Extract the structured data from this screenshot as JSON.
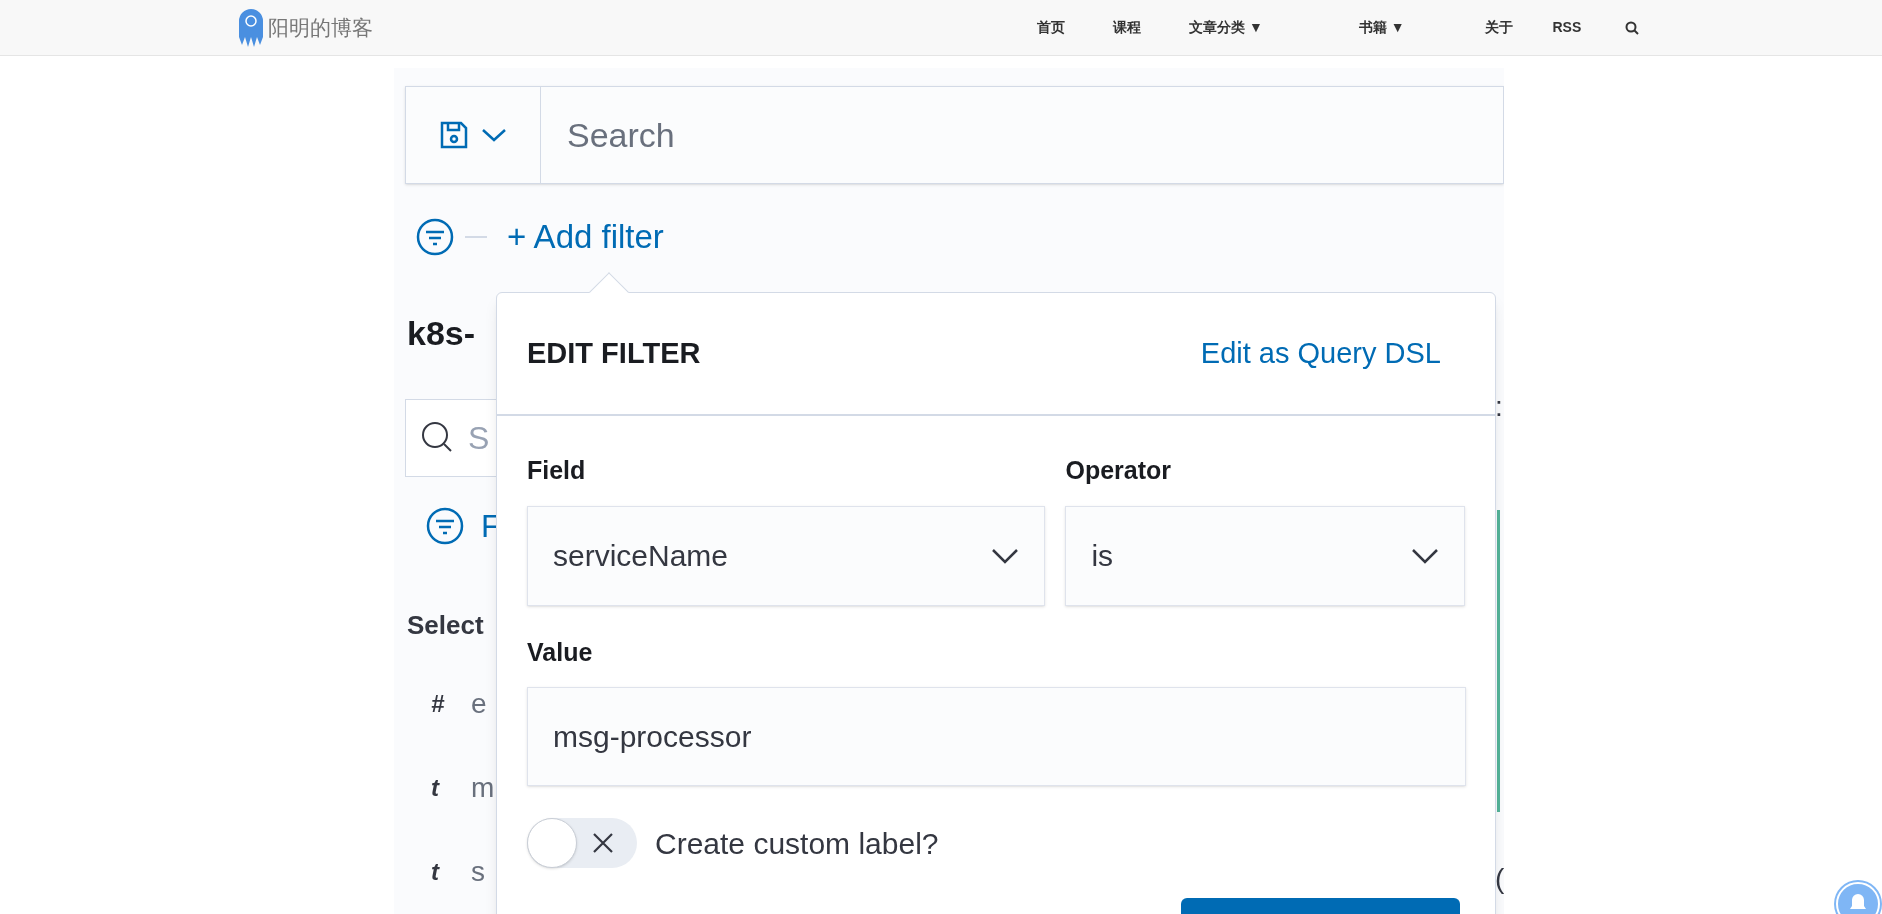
{
  "site": {
    "title": "阳明的博客",
    "nav": [
      {
        "label": "首页"
      },
      {
        "label": "课程"
      },
      {
        "label": "文章分类 ▼"
      },
      {
        "label": "书籍 ▼"
      },
      {
        "label": "关于"
      },
      {
        "label": "RSS"
      }
    ]
  },
  "screenshot": {
    "query_bar": {
      "placeholder": "Search"
    },
    "add_filter": "+ Add filter",
    "background": {
      "title": "k8s-",
      "search_placeholder": "S",
      "filter_link": "F",
      "section": "Select",
      "fields": [
        {
          "type": "#",
          "name": "e"
        },
        {
          "type": "t",
          "name": "m"
        },
        {
          "type": "t",
          "name": "s"
        }
      ],
      "right_fragments": [
        ":",
        "("
      ]
    },
    "popover": {
      "title": "EDIT FILTER",
      "dsl_link": "Edit as Query DSL",
      "field": {
        "label": "Field",
        "value": "serviceName"
      },
      "operator": {
        "label": "Operator",
        "value": "is"
      },
      "value": {
        "label": "Value",
        "value": "msg-processor"
      },
      "custom_label": {
        "label": "Create custom label?",
        "on": false
      }
    }
  }
}
